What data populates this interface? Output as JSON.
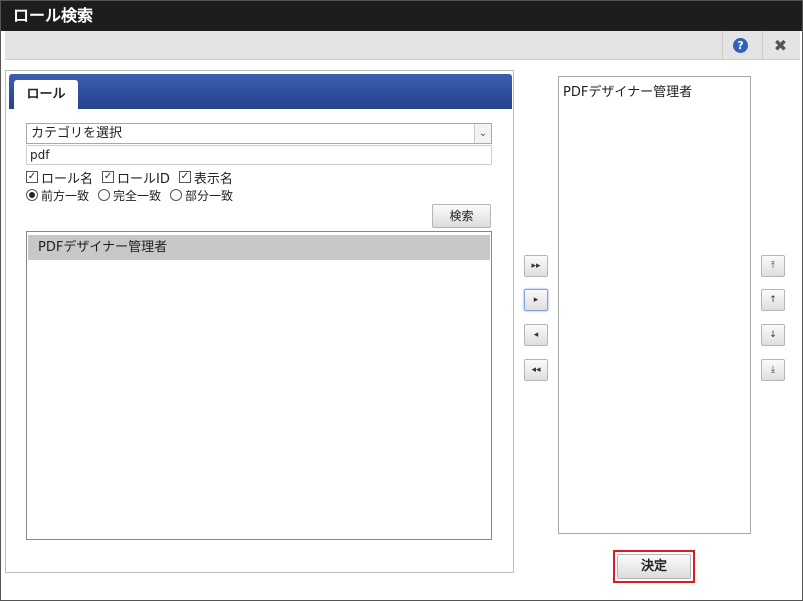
{
  "window": {
    "title": "ロール検索"
  },
  "toolbar": {
    "help_icon_glyph": "?",
    "close_icon_glyph": "✖",
    "help_color": "#2f62b8"
  },
  "tabs": [
    {
      "label": "ロール"
    }
  ],
  "search": {
    "category_selected": "カテゴリを選択",
    "keyword_value": "pdf",
    "checkboxes": [
      {
        "label": "ロール名",
        "checked": true
      },
      {
        "label": "ロールID",
        "checked": true
      },
      {
        "label": "表示名",
        "checked": true
      }
    ],
    "radios": [
      {
        "label": "前方一致",
        "selected": true
      },
      {
        "label": "完全一致",
        "selected": false
      },
      {
        "label": "部分一致",
        "selected": false
      }
    ],
    "search_button_label": "検索"
  },
  "results": [
    {
      "label": "PDFデザイナー管理者"
    }
  ],
  "transfer": {
    "add_all_glyph": "▸▸",
    "add_glyph": "▸",
    "remove_glyph": "◂",
    "remove_all_glyph": "◂◂"
  },
  "selected": [
    {
      "label": "PDFデザイナー管理者"
    }
  ],
  "order": {
    "top_glyph": "⤒",
    "up_glyph": "↑",
    "down_glyph": "↓",
    "bottom_glyph": "⤓"
  },
  "footer": {
    "decide_label": "決定",
    "highlight_color": "#e11a22"
  }
}
